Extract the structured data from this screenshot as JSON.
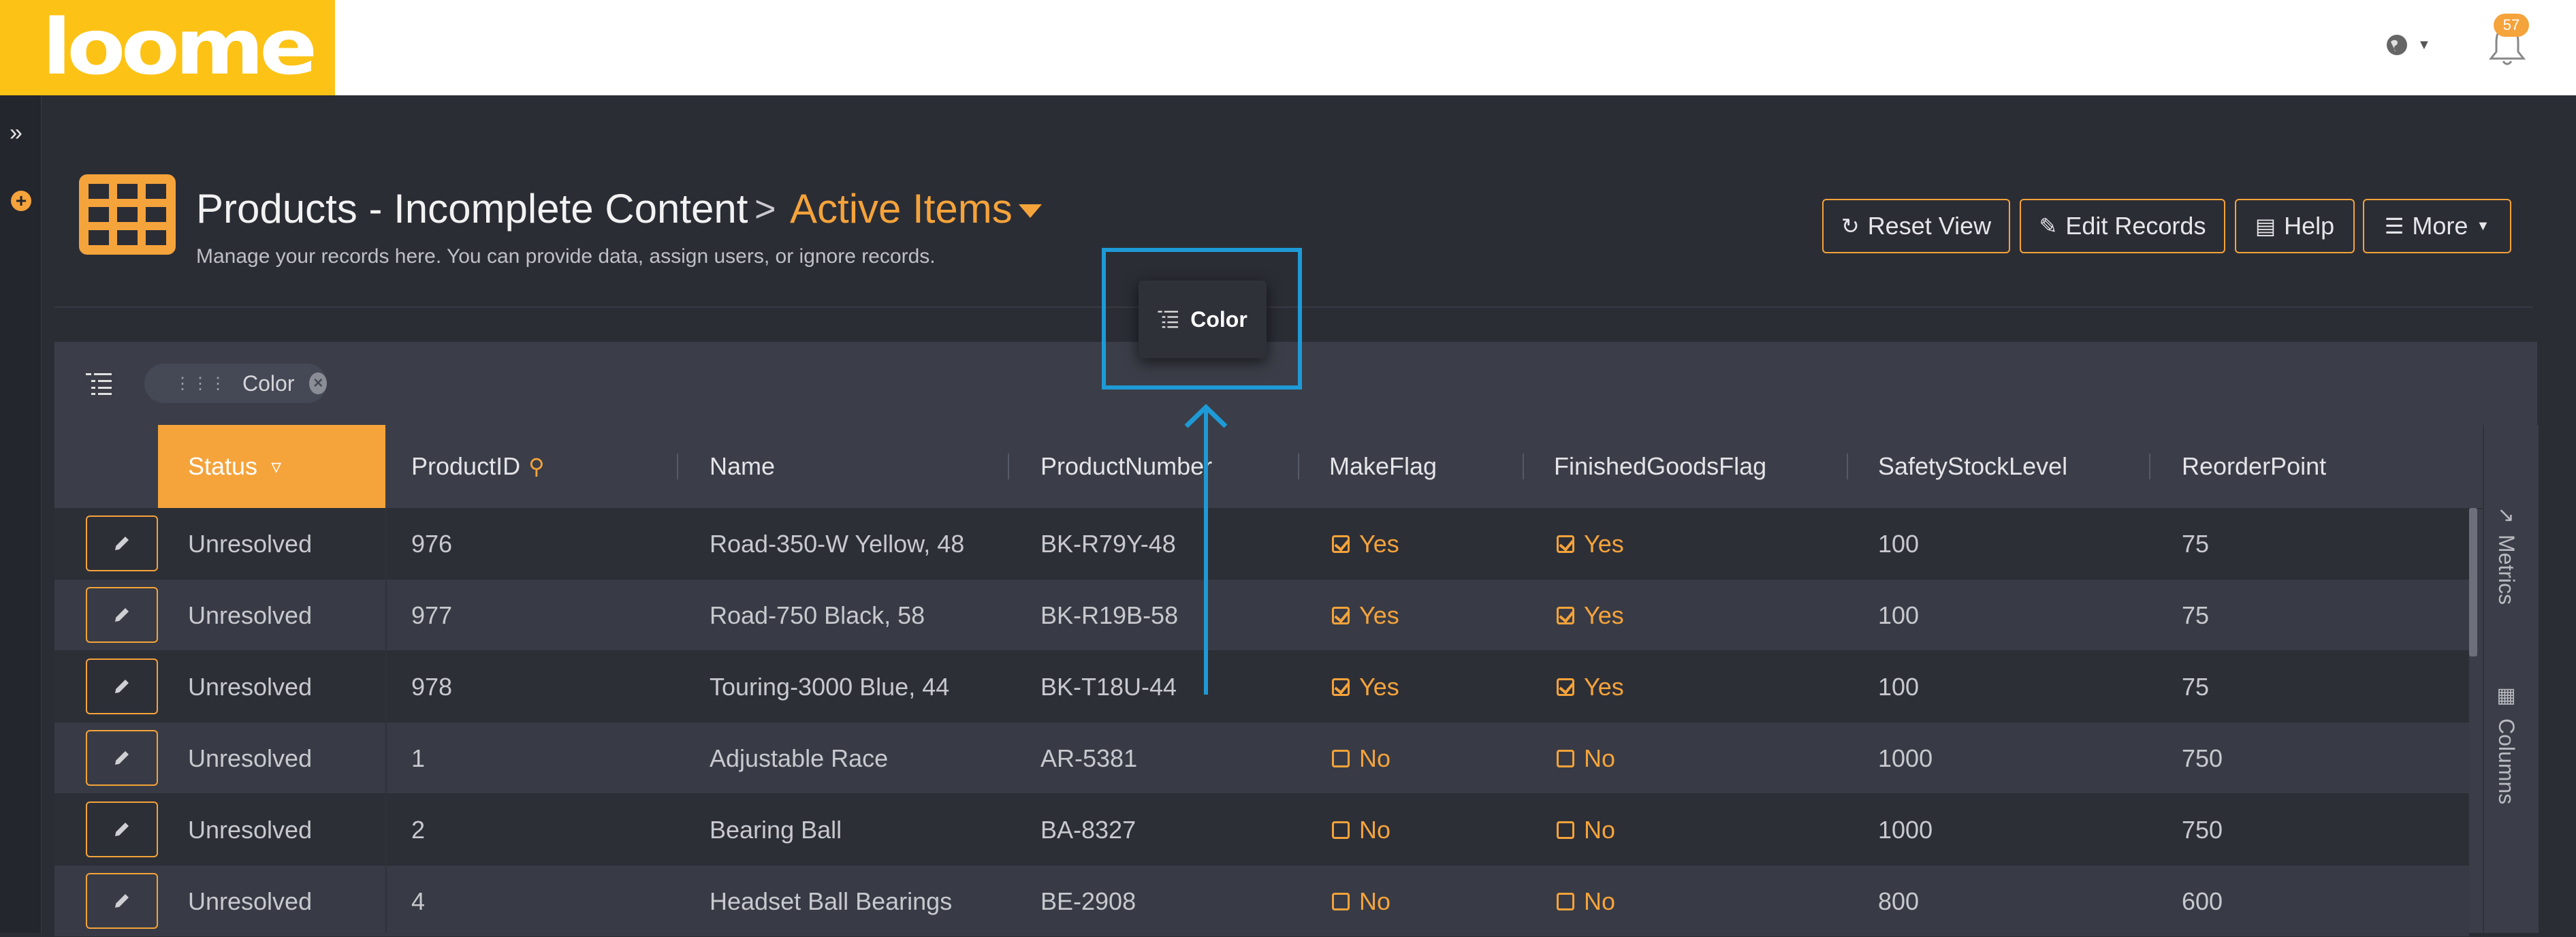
{
  "app": {
    "logo_text": "loome",
    "notifications_count": "57"
  },
  "header": {
    "title": "Products - Incomplete Content",
    "separator": ">",
    "view_name": "Active Items",
    "description": "Manage your records here. You can provide data, assign users, or ignore records."
  },
  "toolbar": {
    "reset_label": "Reset View",
    "edit_label": "Edit Records",
    "help_label": "Help",
    "more_label": "More"
  },
  "grouping": {
    "chip_label": "Color",
    "drag_label": "Color"
  },
  "columns": [
    "Status",
    "ProductID",
    "Name",
    "ProductNumber",
    "MakeFlag",
    "FinishedGoodsFlag",
    "SafetyStockLevel",
    "ReorderPoint"
  ],
  "rows": [
    {
      "status": "Unresolved",
      "id": "976",
      "name": "Road-350-W Yellow, 48",
      "number": "BK-R79Y-48",
      "make": "Yes",
      "make_on": true,
      "finished": "Yes",
      "finished_on": true,
      "safety": "100",
      "reorder": "75"
    },
    {
      "status": "Unresolved",
      "id": "977",
      "name": "Road-750 Black, 58",
      "number": "BK-R19B-58",
      "make": "Yes",
      "make_on": true,
      "finished": "Yes",
      "finished_on": true,
      "safety": "100",
      "reorder": "75"
    },
    {
      "status": "Unresolved",
      "id": "978",
      "name": "Touring-3000 Blue, 44",
      "number": "BK-T18U-44",
      "make": "Yes",
      "make_on": true,
      "finished": "Yes",
      "finished_on": true,
      "safety": "100",
      "reorder": "75"
    },
    {
      "status": "Unresolved",
      "id": "1",
      "name": "Adjustable Race",
      "number": "AR-5381",
      "make": "No",
      "make_on": false,
      "finished": "No",
      "finished_on": false,
      "safety": "1000",
      "reorder": "750"
    },
    {
      "status": "Unresolved",
      "id": "2",
      "name": "Bearing Ball",
      "number": "BA-8327",
      "make": "No",
      "make_on": false,
      "finished": "No",
      "finished_on": false,
      "safety": "1000",
      "reorder": "750"
    },
    {
      "status": "Unresolved",
      "id": "4",
      "name": "Headset Ball Bearings",
      "number": "BE-2908",
      "make": "No",
      "make_on": false,
      "finished": "No",
      "finished_on": false,
      "safety": "800",
      "reorder": "600"
    }
  ],
  "side_tabs": {
    "metrics": "Metrics",
    "columns": "Columns"
  },
  "colors": {
    "accent": "#f5a33b",
    "logo_bg": "#fcc316",
    "highlight": "#1e9ad6",
    "background": "#2b2d35"
  },
  "icons": [
    "globe-icon",
    "bell-icon",
    "expand-icon",
    "add-icon",
    "grid-icon",
    "refresh-icon",
    "pencil-icon",
    "book-icon",
    "list-icon",
    "filter-icon",
    "key-icon",
    "chart-icon",
    "columns-icon",
    "drag-icon",
    "close-icon"
  ]
}
